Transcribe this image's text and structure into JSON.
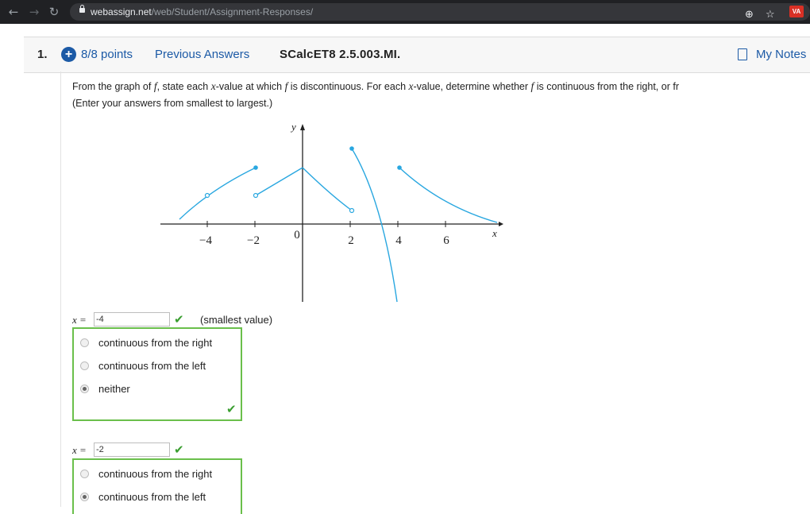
{
  "browser": {
    "back_icon": "←",
    "forward_icon": "→",
    "reload_icon": "↻",
    "url_host": "webassign.net",
    "url_path": "/web/Student/Assignment-Responses/",
    "zoom_icon": "⊕",
    "star_icon": "☆",
    "extension_label": "VA"
  },
  "question": {
    "number": "1.",
    "points": "8/8 points",
    "previous_answers": "Previous Answers",
    "code": "SCalcET8 2.5.003.MI.",
    "my_notes": "My Notes",
    "prompt_part1": "From the graph of ",
    "prompt_f1": "f",
    "prompt_part2": ", state each ",
    "prompt_x1": "x",
    "prompt_part3": "-value at which ",
    "prompt_f2": "f",
    "prompt_part4": " is discontinuous. For each ",
    "prompt_x2": "x",
    "prompt_part5": "-value, determine whether ",
    "prompt_f3": "f",
    "prompt_part6": " is continuous from the right, or fr",
    "prompt_line2": "(Enter your answers from smallest to largest.)"
  },
  "graph": {
    "y_axis_label": "y",
    "x_axis_label": "x",
    "ticks": [
      "−4",
      "−2",
      "0",
      "2",
      "4",
      "6"
    ],
    "curve_color": "#29a7e0"
  },
  "answers": [
    {
      "x_label": "x =",
      "value": "-4",
      "note": "(smallest value)",
      "options": [
        "continuous from the right",
        "continuous from the left",
        "neither"
      ],
      "selected": 2,
      "correct": true
    },
    {
      "x_label": "x =",
      "value": "-2",
      "note": "",
      "options": [
        "continuous from the right",
        "continuous from the left"
      ],
      "selected": 1,
      "correct": true
    }
  ],
  "check_symbol": "✔",
  "colors": {
    "link_blue": "#1c5aa6",
    "correct_green": "#6abf4b",
    "chrome_dark": "#202124"
  }
}
